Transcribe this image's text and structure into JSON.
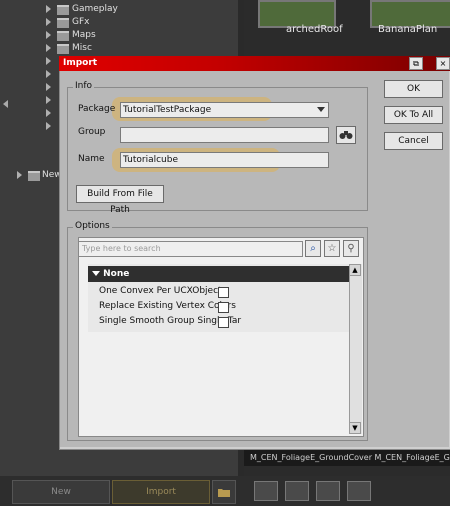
{
  "tree": {
    "items": [
      {
        "label": "Gameplay"
      },
      {
        "label": "GFx"
      },
      {
        "label": "Maps"
      },
      {
        "label": "Misc"
      },
      {
        "label": ""
      },
      {
        "label": ""
      },
      {
        "label": ""
      },
      {
        "label": ""
      },
      {
        "label": ""
      },
      {
        "label": ""
      }
    ],
    "new_folder_label": "New"
  },
  "thumbnails": {
    "items": [
      {
        "label": "archedRoof"
      },
      {
        "label": "BananaPlan"
      }
    ],
    "bottom_text": "M_CEN_FoliageE_GroundCover M_CEN_FoliageE_Gr"
  },
  "bottom_bar": {
    "new_label": "New",
    "import_label": "Import"
  },
  "dialog": {
    "title": "Import",
    "title_buttons": {
      "restore": "⧉",
      "close": "×"
    },
    "info_group_label": "Info",
    "package_label": "Package",
    "package_value": "TutorialTestPackage",
    "group_label": "Group",
    "group_value": "",
    "name_label": "Name",
    "name_value": "Tutorialcube",
    "build_from_file_path_label": "Build From File Path",
    "ok_label": "OK",
    "ok_to_all_label": "OK To All",
    "cancel_label": "Cancel",
    "options_group_label": "Options",
    "search_placeholder": "Type here to search",
    "category_label": "None",
    "properties": [
      {
        "label": "One Convex Per UCXObject",
        "checked": false
      },
      {
        "label": "Replace Existing Vertex Colors",
        "checked": false
      },
      {
        "label": "Single Smooth Group Single Tar",
        "checked": false
      }
    ]
  },
  "colors": {
    "title_bar": "#e00000",
    "highlight": "#e6af3c",
    "dialog_bg": "#b8b8b8"
  },
  "icons": [
    "collapse-arrow-icon",
    "folder-icon",
    "binoculars-icon",
    "search-icon",
    "star-icon",
    "filter-icon",
    "scroll-up-icon",
    "scroll-down-icon",
    "triangle-down-icon",
    "restore-icon",
    "close-icon",
    "folder-open-icon",
    "view-mode-icon"
  ]
}
